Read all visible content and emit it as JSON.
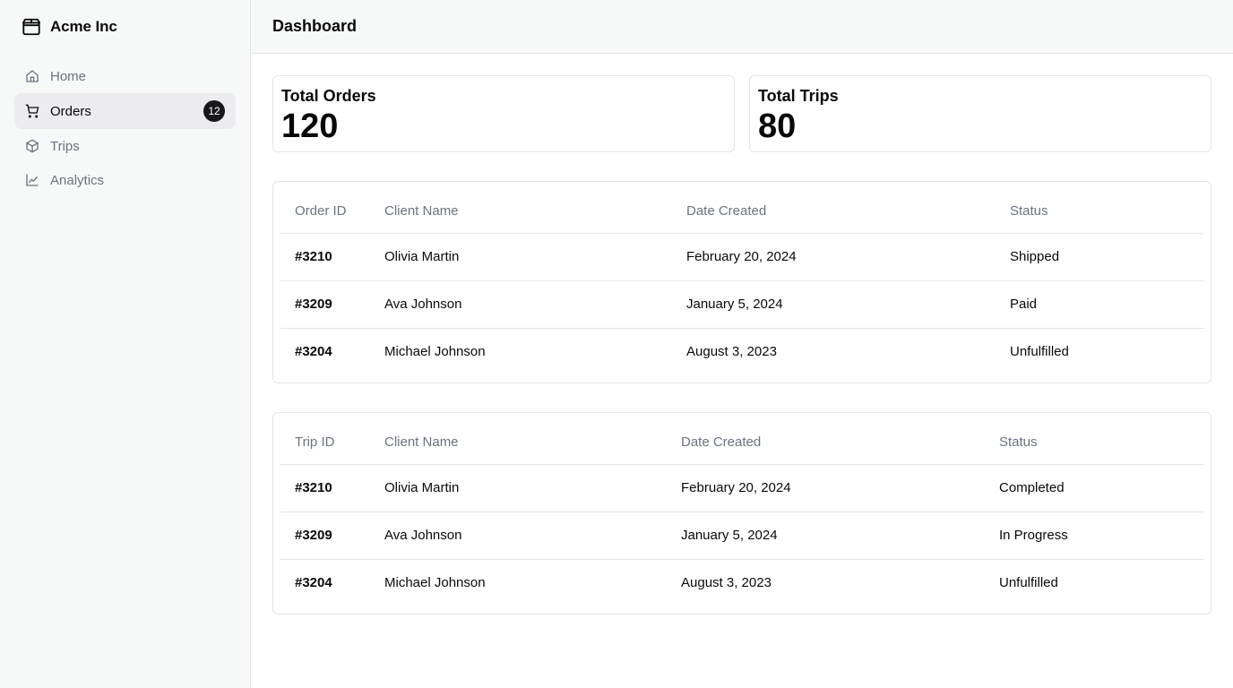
{
  "brand": {
    "name": "Acme Inc",
    "icon": "package-icon"
  },
  "sidebar": {
    "items": [
      {
        "label": "Home",
        "icon": "home-icon"
      },
      {
        "label": "Orders",
        "icon": "cart-icon",
        "badge": "12",
        "active": true
      },
      {
        "label": "Trips",
        "icon": "box-icon"
      },
      {
        "label": "Analytics",
        "icon": "chart-line-icon"
      }
    ]
  },
  "header": {
    "title": "Dashboard"
  },
  "stats": [
    {
      "label": "Total Orders",
      "value": "120"
    },
    {
      "label": "Total Trips",
      "value": "80"
    }
  ],
  "orders_table": {
    "headers": [
      "Order ID",
      "Client Name",
      "Date Created",
      "Status"
    ],
    "rows": [
      [
        "#3210",
        "Olivia Martin",
        "February 20, 2024",
        "Shipped"
      ],
      [
        "#3209",
        "Ava Johnson",
        "January 5, 2024",
        "Paid"
      ],
      [
        "#3204",
        "Michael Johnson",
        "August 3, 2023",
        "Unfulfilled"
      ]
    ]
  },
  "trips_table": {
    "headers": [
      "Trip ID",
      "Client Name",
      "Date Created",
      "Status"
    ],
    "rows": [
      [
        "#3210",
        "Olivia Martin",
        "February 20, 2024",
        "Completed"
      ],
      [
        "#3209",
        "Ava Johnson",
        "January 5, 2024",
        "In Progress"
      ],
      [
        "#3204",
        "Michael Johnson",
        "August 3, 2023",
        "Unfulfilled"
      ]
    ]
  },
  "colors": {
    "sidebar_bg": "#f7f8f8",
    "active_bg": "#ececee",
    "badge_bg": "#18181b",
    "border": "#e4e4e7",
    "muted_text": "#6b7280"
  }
}
